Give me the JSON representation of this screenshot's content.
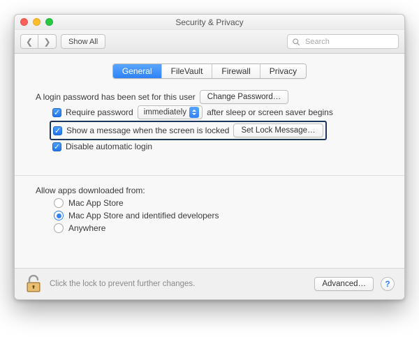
{
  "window": {
    "title": "Security & Privacy"
  },
  "toolbar": {
    "show_all": "Show All",
    "search_placeholder": "Search"
  },
  "tabs": [
    "General",
    "FileVault",
    "Firewall",
    "Privacy"
  ],
  "general": {
    "login_password_sentence": "A login password has been set for this user",
    "change_password_btn": "Change Password…",
    "require_password_label": "Require password",
    "require_password_delay": "immediately",
    "require_password_tail": "after sleep or screen saver begins",
    "show_message_label": "Show a message when the screen is locked",
    "set_lock_message_btn": "Set Lock Message…",
    "disable_auto_login_label": "Disable automatic login"
  },
  "allow_apps": {
    "heading": "Allow apps downloaded from:",
    "options": [
      "Mac App Store",
      "Mac App Store and identified developers",
      "Anywhere"
    ],
    "selected_index": 1
  },
  "footer": {
    "lock_text": "Click the lock to prevent further changes.",
    "advanced_btn": "Advanced…",
    "help_symbol": "?"
  }
}
